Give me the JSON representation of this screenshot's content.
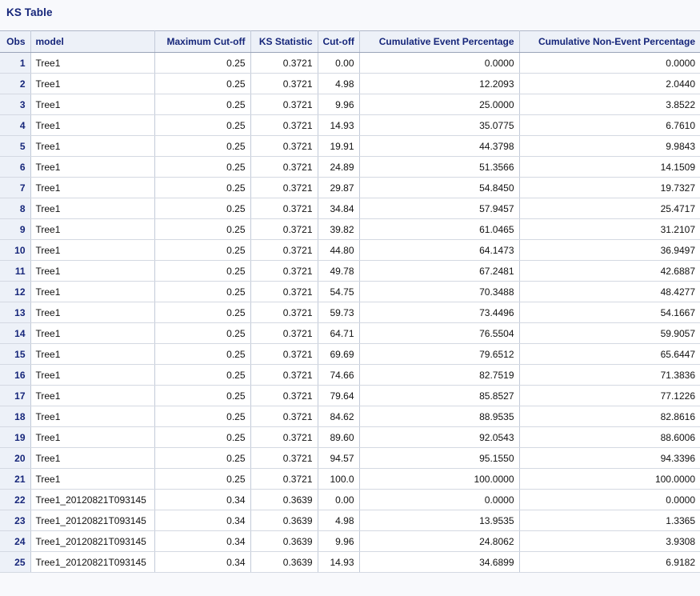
{
  "page": {
    "title": "KS Table",
    "title_color": "#16267a",
    "background_color": "#f8f9fc",
    "header_background": "#edf1f8",
    "obs_column_background": "#edf1f8",
    "cell_background": "#ffffff",
    "border_color": "#c3cbd9"
  },
  "table": {
    "name": "ks-table",
    "columns": [
      {
        "key": "obs",
        "label": "Obs",
        "align": "right"
      },
      {
        "key": "model",
        "label": "model",
        "align": "left"
      },
      {
        "key": "maxcut",
        "label": "Maximum Cut-off",
        "align": "right"
      },
      {
        "key": "ks",
        "label": "KS Statistic",
        "align": "right"
      },
      {
        "key": "cut",
        "label": "Cut-off",
        "align": "right"
      },
      {
        "key": "cep",
        "label": "Cumulative Event Percentage",
        "align": "right"
      },
      {
        "key": "cnep",
        "label": "Cumulative Non-Event Percentage",
        "align": "right"
      }
    ],
    "rows": [
      {
        "obs": "1",
        "model": "Tree1",
        "maxcut": "0.25",
        "ks": "0.3721",
        "cut": "0.00",
        "cep": "0.0000",
        "cnep": "0.0000"
      },
      {
        "obs": "2",
        "model": "Tree1",
        "maxcut": "0.25",
        "ks": "0.3721",
        "cut": "4.98",
        "cep": "12.2093",
        "cnep": "2.0440"
      },
      {
        "obs": "3",
        "model": "Tree1",
        "maxcut": "0.25",
        "ks": "0.3721",
        "cut": "9.96",
        "cep": "25.0000",
        "cnep": "3.8522"
      },
      {
        "obs": "4",
        "model": "Tree1",
        "maxcut": "0.25",
        "ks": "0.3721",
        "cut": "14.93",
        "cep": "35.0775",
        "cnep": "6.7610"
      },
      {
        "obs": "5",
        "model": "Tree1",
        "maxcut": "0.25",
        "ks": "0.3721",
        "cut": "19.91",
        "cep": "44.3798",
        "cnep": "9.9843"
      },
      {
        "obs": "6",
        "model": "Tree1",
        "maxcut": "0.25",
        "ks": "0.3721",
        "cut": "24.89",
        "cep": "51.3566",
        "cnep": "14.1509"
      },
      {
        "obs": "7",
        "model": "Tree1",
        "maxcut": "0.25",
        "ks": "0.3721",
        "cut": "29.87",
        "cep": "54.8450",
        "cnep": "19.7327"
      },
      {
        "obs": "8",
        "model": "Tree1",
        "maxcut": "0.25",
        "ks": "0.3721",
        "cut": "34.84",
        "cep": "57.9457",
        "cnep": "25.4717"
      },
      {
        "obs": "9",
        "model": "Tree1",
        "maxcut": "0.25",
        "ks": "0.3721",
        "cut": "39.82",
        "cep": "61.0465",
        "cnep": "31.2107"
      },
      {
        "obs": "10",
        "model": "Tree1",
        "maxcut": "0.25",
        "ks": "0.3721",
        "cut": "44.80",
        "cep": "64.1473",
        "cnep": "36.9497"
      },
      {
        "obs": "11",
        "model": "Tree1",
        "maxcut": "0.25",
        "ks": "0.3721",
        "cut": "49.78",
        "cep": "67.2481",
        "cnep": "42.6887"
      },
      {
        "obs": "12",
        "model": "Tree1",
        "maxcut": "0.25",
        "ks": "0.3721",
        "cut": "54.75",
        "cep": "70.3488",
        "cnep": "48.4277"
      },
      {
        "obs": "13",
        "model": "Tree1",
        "maxcut": "0.25",
        "ks": "0.3721",
        "cut": "59.73",
        "cep": "73.4496",
        "cnep": "54.1667"
      },
      {
        "obs": "14",
        "model": "Tree1",
        "maxcut": "0.25",
        "ks": "0.3721",
        "cut": "64.71",
        "cep": "76.5504",
        "cnep": "59.9057"
      },
      {
        "obs": "15",
        "model": "Tree1",
        "maxcut": "0.25",
        "ks": "0.3721",
        "cut": "69.69",
        "cep": "79.6512",
        "cnep": "65.6447"
      },
      {
        "obs": "16",
        "model": "Tree1",
        "maxcut": "0.25",
        "ks": "0.3721",
        "cut": "74.66",
        "cep": "82.7519",
        "cnep": "71.3836"
      },
      {
        "obs": "17",
        "model": "Tree1",
        "maxcut": "0.25",
        "ks": "0.3721",
        "cut": "79.64",
        "cep": "85.8527",
        "cnep": "77.1226"
      },
      {
        "obs": "18",
        "model": "Tree1",
        "maxcut": "0.25",
        "ks": "0.3721",
        "cut": "84.62",
        "cep": "88.9535",
        "cnep": "82.8616"
      },
      {
        "obs": "19",
        "model": "Tree1",
        "maxcut": "0.25",
        "ks": "0.3721",
        "cut": "89.60",
        "cep": "92.0543",
        "cnep": "88.6006"
      },
      {
        "obs": "20",
        "model": "Tree1",
        "maxcut": "0.25",
        "ks": "0.3721",
        "cut": "94.57",
        "cep": "95.1550",
        "cnep": "94.3396"
      },
      {
        "obs": "21",
        "model": "Tree1",
        "maxcut": "0.25",
        "ks": "0.3721",
        "cut": "100.0",
        "cep": "100.0000",
        "cnep": "100.0000"
      },
      {
        "obs": "22",
        "model": "Tree1_20120821T093145",
        "maxcut": "0.34",
        "ks": "0.3639",
        "cut": "0.00",
        "cep": "0.0000",
        "cnep": "0.0000"
      },
      {
        "obs": "23",
        "model": "Tree1_20120821T093145",
        "maxcut": "0.34",
        "ks": "0.3639",
        "cut": "4.98",
        "cep": "13.9535",
        "cnep": "1.3365"
      },
      {
        "obs": "24",
        "model": "Tree1_20120821T093145",
        "maxcut": "0.34",
        "ks": "0.3639",
        "cut": "9.96",
        "cep": "24.8062",
        "cnep": "3.9308"
      },
      {
        "obs": "25",
        "model": "Tree1_20120821T093145",
        "maxcut": "0.34",
        "ks": "0.3639",
        "cut": "14.93",
        "cep": "34.6899",
        "cnep": "6.9182"
      }
    ]
  }
}
